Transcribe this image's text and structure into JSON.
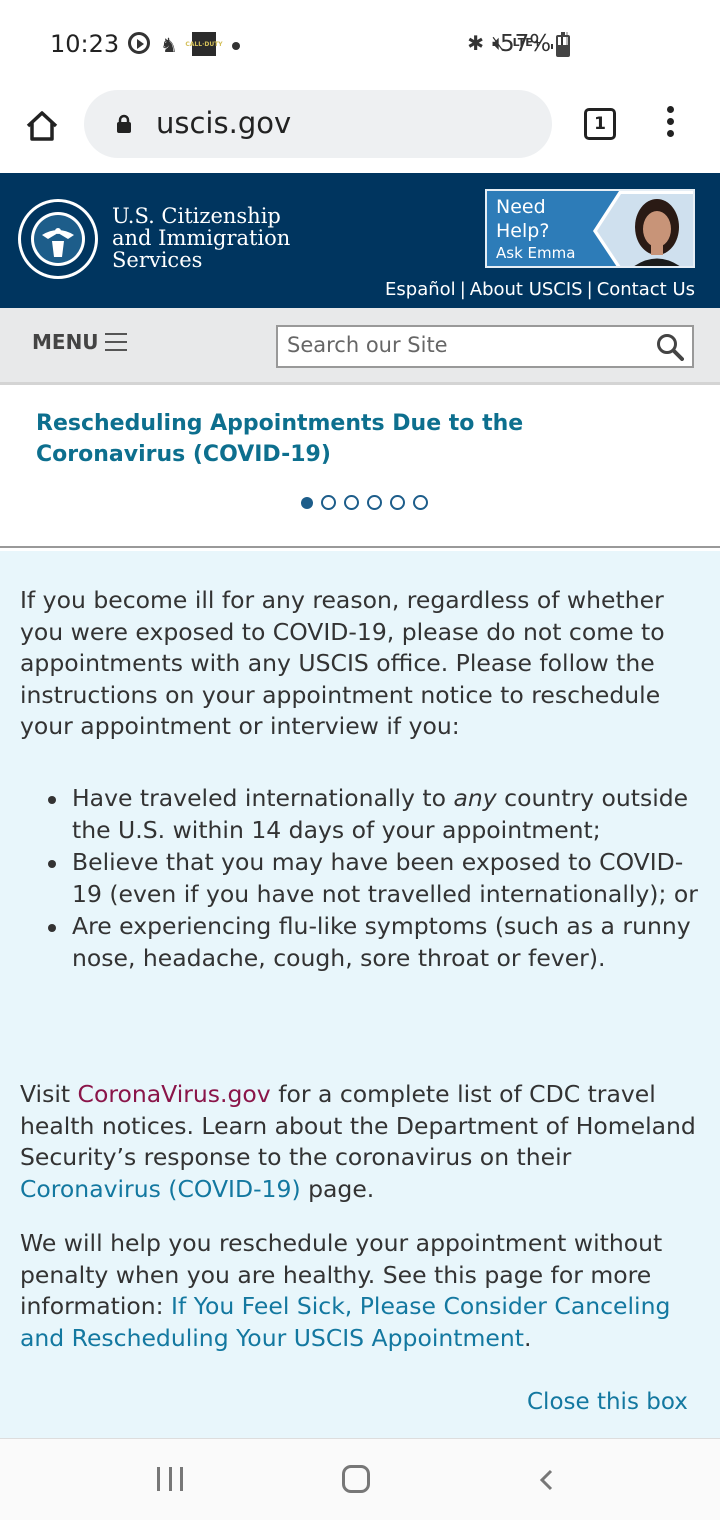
{
  "status_bar": {
    "time": "10:23",
    "thumb_text": "CALL·DUTY",
    "network": "LTE+",
    "battery_pct": "57%",
    "battery_level": 0.57
  },
  "browser": {
    "url": "uscis.gov",
    "tab_count": "1"
  },
  "header": {
    "agency_line1": "U.S. Citizenship",
    "agency_line2": "and Immigration",
    "agency_line3": "Services",
    "help_line1": "Need",
    "help_line2": "Help?",
    "help_sub": "Ask Emma",
    "links": [
      "Español",
      "About USCIS",
      "Contact Us"
    ],
    "separator": "|",
    "colors": {
      "navy": "#00355f",
      "help_blue": "#2d7cb8"
    }
  },
  "menu": {
    "label": "MENU",
    "search_placeholder": "Search our Site"
  },
  "carousel": {
    "headline": "Rescheduling Appointments Due to the Coronavirus (COVID-19)",
    "slide_count": 6,
    "active_slide": 1
  },
  "alert": {
    "intro": "If you become ill for any reason, regardless of whether you were exposed to COVID-19, please do not come to appointments with any USCIS office. Please follow the instructions on your appointment notice to reschedule your appointment or interview if you:",
    "bullet1_pre": "Have traveled internationally to ",
    "bullet1_em": "any",
    "bullet1_post": " country outside the U.S. within 14 days of your appointment;",
    "bullet2": "Believe that you may have been exposed to COVID-19 (even if you have not travelled internationally); or",
    "bullet3": "Are experiencing flu-like symptoms (such as a runny nose, headache, cough, sore throat or fever).",
    "visit_pre": "Visit ",
    "visit_link": "CoronaVirus.gov",
    "visit_mid": " for a complete list of CDC travel health notices. Learn about the Department of Homeland Security’s response to the coronavirus on their ",
    "visit_link2": "Coronavirus (COVID-19)",
    "visit_post": " page.",
    "help_pre": "We will help you reschedule your appointment without penalty when you are healthy. See this page for more information: ",
    "help_link": "If You Feel Sick, Please Consider Canceling and Rescheduling Your USCIS Appointment",
    "help_post": ".",
    "close_label": "Close this box",
    "colors": {
      "background": "#e8f6fb",
      "link_teal": "#1378a0",
      "link_maroon": "#8a1549"
    }
  },
  "icons": {
    "home": "home-icon",
    "lock": "lock-icon",
    "tabs": "tab-switcher-icon",
    "more": "more-vert-icon",
    "search": "search-icon",
    "seal": "dhs-seal-icon"
  }
}
